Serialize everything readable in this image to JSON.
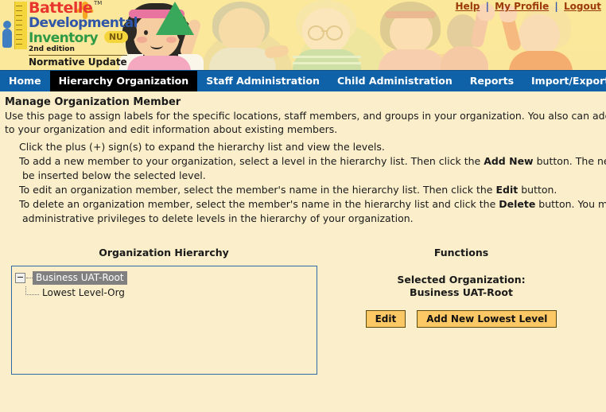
{
  "brand": {
    "line1": "Battelle",
    "line2": "Developmental",
    "line3": "Inventory",
    "badge": "NU",
    "edition": "2nd edition",
    "normative": "Normative Update",
    "tm": "TM"
  },
  "header_links": {
    "help": "Help",
    "separator": "|",
    "my_profile": "My Profile",
    "logout": "Logout"
  },
  "nav": {
    "items": [
      {
        "label": "Home",
        "active": false
      },
      {
        "label": "Hierarchy Organization",
        "active": true
      },
      {
        "label": "Staff Administration",
        "active": false
      },
      {
        "label": "Child Administration",
        "active": false
      },
      {
        "label": "Reports",
        "active": false
      },
      {
        "label": "Import/Export",
        "active": false
      }
    ]
  },
  "main": {
    "title": "Manage Organization Member",
    "intro_line1": "Use this page to assign labels for the specific locations, staff members, and groups in your organization. You also can add new mem",
    "intro_line2": "to your organization and edit information about existing members.",
    "bullets": [
      {
        "line1_pre": "Click the plus (+) sign(s) to expand the hierarchy list and view the levels.",
        "bold": "",
        "line1_post": "",
        "line2": ""
      },
      {
        "line1_pre": "To add a new member to your organization, select a level in the hierarchy list. Then click the ",
        "bold": "Add New",
        "line1_post": " button. The new membe",
        "line2": "be inserted below the selected level."
      },
      {
        "line1_pre": "To edit an organization member, select the member's name in the hierarchy list. Then click the ",
        "bold": "Edit",
        "line1_post": " button.",
        "line2": ""
      },
      {
        "line1_pre": "To delete an organization member, select the member's name in the hierarchy list and click the ",
        "bold": "Delete",
        "line1_post": " button. You must have",
        "line2": "administrative privileges to delete levels in the hierarchy of your organization."
      }
    ]
  },
  "hierarchy": {
    "heading": "Organization Hierarchy",
    "root": {
      "label": "Business UAT-Root",
      "expander": "minus-icon",
      "selected": true
    },
    "children": [
      {
        "label": "Lowest Level-Org"
      }
    ]
  },
  "functions": {
    "heading": "Functions",
    "selected_label": "Selected Organization:",
    "selected_value": "Business UAT-Root",
    "edit_button": "Edit",
    "add_button": "Add New Lowest Level"
  },
  "colors": {
    "page_background": "#faeecb",
    "banner_background": "#fbe89a",
    "nav_background": "#0f62a8",
    "nav_active_background": "#000000",
    "link_color": "#9c3a0a",
    "button_background": "#fcc765",
    "tree_border": "#2f6aa8",
    "selection_background": "#808080"
  }
}
